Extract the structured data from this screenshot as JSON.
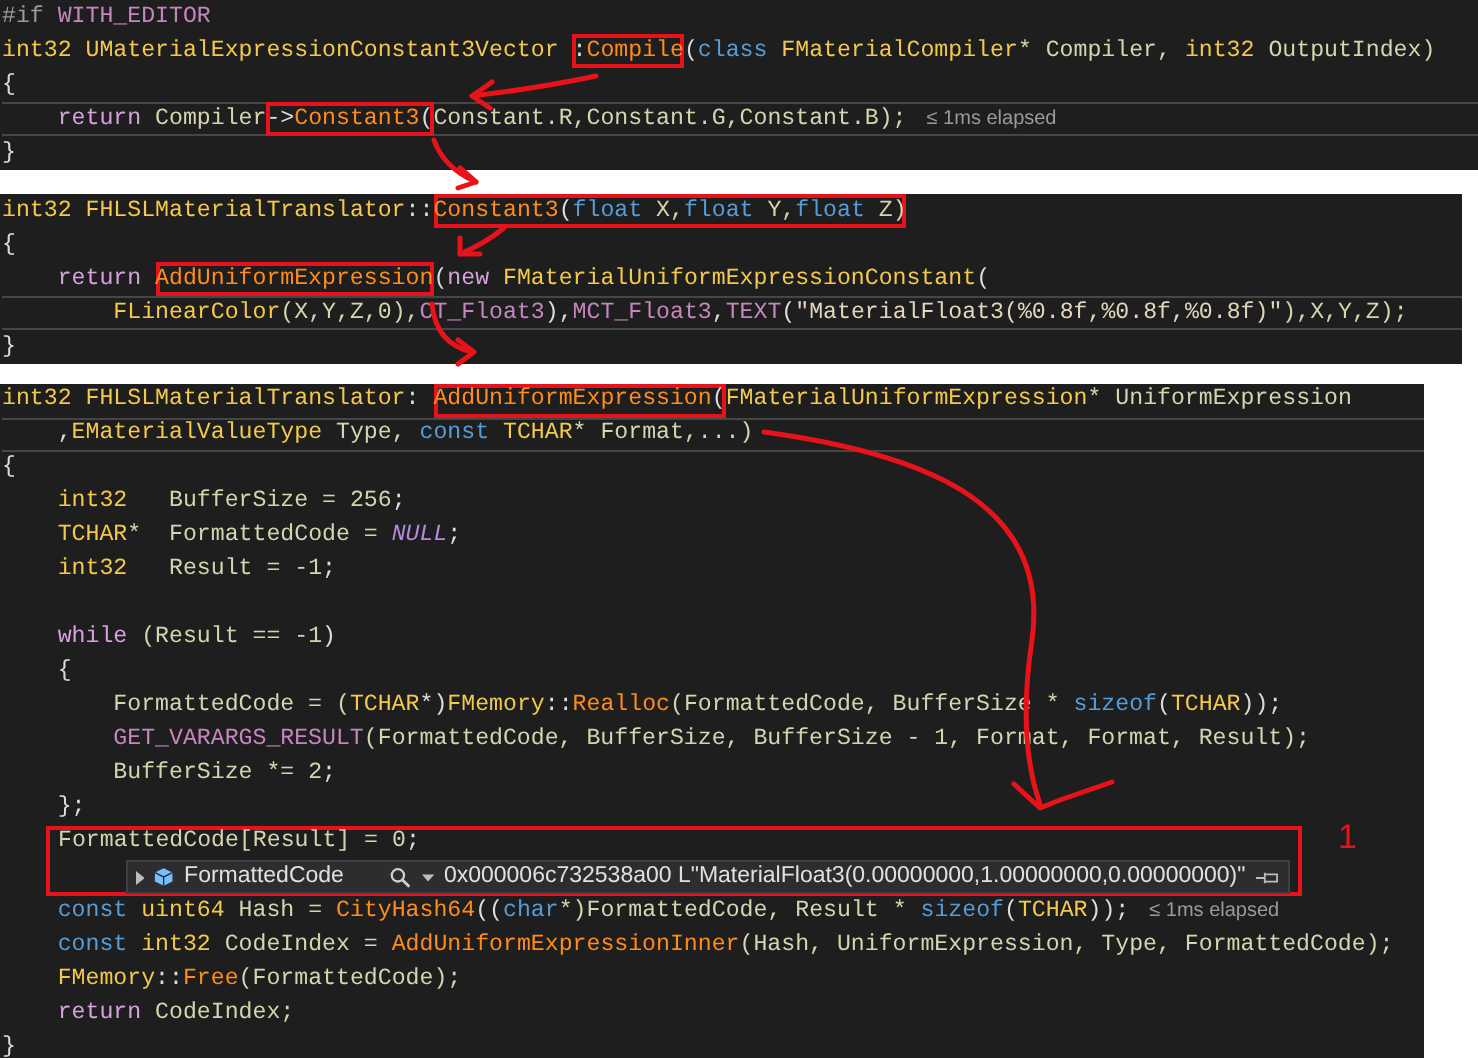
{
  "panels": [
    {
      "lines": [
        {
          "kind": "code",
          "current": false,
          "tokens": [
            {
              "text": "#if ",
              "kind": "pre"
            },
            {
              "text": "WITH_EDITOR",
              "kind": "macro"
            }
          ]
        },
        {
          "kind": "code",
          "current": false,
          "tokens": [
            {
              "text": "int32 ",
              "kind": "type"
            },
            {
              "text": "UMaterialExpressionConstant3Vector ",
              "kind": "type"
            },
            {
              "kind": "box",
              "tokens": [
                {
                  "text": ":",
                  "kind": "p"
                },
                {
                  "text": "Compile",
                  "kind": "fn"
                }
              ]
            },
            {
              "text": "(",
              "kind": "p"
            },
            {
              "text": "class ",
              "kind": "kw2"
            },
            {
              "text": "FMaterialCompiler",
              "kind": "type"
            },
            {
              "text": "* Compiler, ",
              "kind": "id"
            },
            {
              "text": "int32",
              "kind": "type"
            },
            {
              "text": " OutputIndex)",
              "kind": "id"
            }
          ]
        },
        {
          "kind": "code",
          "current": false,
          "tokens": [
            {
              "text": "{",
              "kind": "p"
            }
          ]
        },
        {
          "kind": "code",
          "current": true,
          "tokens": [
            {
              "text": "    return",
              "kind": "kw"
            },
            {
              "text": " Compiler",
              "kind": "id"
            },
            {
              "kind": "box",
              "tokens": [
                {
                  "text": "->",
                  "kind": "p"
                },
                {
                  "text": "Constant3",
                  "kind": "fn"
                },
                {
                  "text": "(",
                  "kind": "p"
                }
              ]
            },
            {
              "text": "Constant.R,Constant.G,Constant.B);",
              "kind": "id"
            },
            {
              "text": "≤ 1ms elapsed",
              "kind": "perf"
            }
          ]
        },
        {
          "kind": "code",
          "current": false,
          "tokens": [
            {
              "text": "}",
              "kind": "p"
            }
          ]
        }
      ]
    },
    {
      "lines": [
        {
          "kind": "code",
          "current": false,
          "tokens": [
            {
              "text": "int32 ",
              "kind": "type"
            },
            {
              "text": "FHLSLMaterialTranslator",
              "kind": "type"
            },
            {
              "text": "::",
              "kind": "p"
            },
            {
              "kind": "box",
              "tokens": [
                {
                  "text": "Constant3",
                  "kind": "fn"
                },
                {
                  "text": "(",
                  "kind": "p"
                },
                {
                  "text": "float",
                  "kind": "kw2"
                },
                {
                  "text": " X,",
                  "kind": "id"
                },
                {
                  "text": "float",
                  "kind": "kw2"
                },
                {
                  "text": " Y,",
                  "kind": "id"
                },
                {
                  "text": "float",
                  "kind": "kw2"
                },
                {
                  "text": " Z)",
                  "kind": "id"
                }
              ]
            }
          ]
        },
        {
          "kind": "code",
          "current": false,
          "tokens": [
            {
              "text": "{",
              "kind": "p"
            }
          ]
        },
        {
          "kind": "code",
          "current": false,
          "tokens": [
            {
              "text": "    return ",
              "kind": "kw"
            },
            {
              "kind": "box",
              "tokens": [
                {
                  "text": "AddUniformExpression",
                  "kind": "fn"
                }
              ]
            },
            {
              "text": "(",
              "kind": "p"
            },
            {
              "text": "new ",
              "kind": "kw"
            },
            {
              "text": "FMaterialUniformExpressionConstant",
              "kind": "type"
            },
            {
              "text": "(",
              "kind": "p"
            }
          ]
        },
        {
          "kind": "code",
          "current": true,
          "tokens": [
            {
              "text": "        FLinearColor",
              "kind": "type"
            },
            {
              "text": "(X,Y,Z,0),",
              "kind": "id"
            },
            {
              "text": "CT_Float3",
              "kind": "macro"
            },
            {
              "text": "),",
              "kind": "p"
            },
            {
              "text": "MCT_Float3",
              "kind": "macro"
            },
            {
              "text": ",",
              "kind": "p"
            },
            {
              "text": "TEXT",
              "kind": "macro"
            },
            {
              "text": "(",
              "kind": "p"
            },
            {
              "text": "\"MaterialFloat3(%0.8f,%0.8f,%0.8f)\"",
              "kind": "str"
            },
            {
              "text": "),X,Y,Z);",
              "kind": "id"
            }
          ]
        },
        {
          "kind": "code",
          "current": false,
          "tokens": [
            {
              "text": "}",
              "kind": "p"
            }
          ]
        }
      ]
    },
    {
      "lines": [
        {
          "kind": "code",
          "current": false,
          "tokens": [
            {
              "text": "int32 ",
              "kind": "type"
            },
            {
              "text": "FHLSLMaterialTranslator",
              "kind": "type"
            },
            {
              "text": ": ",
              "kind": "p"
            },
            {
              "kind": "box",
              "tokens": [
                {
                  "text": "AddUniformExpression",
                  "kind": "fn"
                },
                {
                  "text": "(",
                  "kind": "p"
                }
              ]
            },
            {
              "text": "FMaterialUniformExpression",
              "kind": "type"
            },
            {
              "text": "* UniformExpression",
              "kind": "id"
            }
          ]
        },
        {
          "kind": "code",
          "current": true,
          "tokens": [
            {
              "text": "    ,",
              "kind": "p"
            },
            {
              "text": "EMaterialValueType",
              "kind": "type"
            },
            {
              "text": " Type, ",
              "kind": "id"
            },
            {
              "text": "const ",
              "kind": "kw2"
            },
            {
              "text": "TCHAR",
              "kind": "type"
            },
            {
              "text": "* Format,...)",
              "kind": "id"
            }
          ]
        },
        {
          "kind": "code",
          "current": false,
          "tokens": [
            {
              "text": "{",
              "kind": "p"
            }
          ]
        },
        {
          "kind": "code",
          "current": false,
          "tokens": [
            {
              "text": "    int32",
              "kind": "type"
            },
            {
              "text": "   BufferSize = ",
              "kind": "id"
            },
            {
              "text": "256",
              "kind": "num"
            },
            {
              "text": ";",
              "kind": "p"
            }
          ]
        },
        {
          "kind": "code",
          "current": false,
          "tokens": [
            {
              "text": "    TCHAR",
              "kind": "type"
            },
            {
              "text": "*  FormattedCode = ",
              "kind": "id"
            },
            {
              "text": "NULL",
              "kind": "null"
            },
            {
              "text": ";",
              "kind": "p"
            }
          ]
        },
        {
          "kind": "code",
          "current": false,
          "tokens": [
            {
              "text": "    int32",
              "kind": "type"
            },
            {
              "text": "   Result = ",
              "kind": "id"
            },
            {
              "text": "-1",
              "kind": "num"
            },
            {
              "text": ";",
              "kind": "p"
            }
          ]
        },
        {
          "kind": "blank",
          "current": false
        },
        {
          "kind": "code",
          "current": false,
          "tokens": [
            {
              "text": "    while",
              "kind": "kw"
            },
            {
              "text": " (Result == ",
              "kind": "id"
            },
            {
              "text": "-1",
              "kind": "num"
            },
            {
              "text": ")",
              "kind": "p"
            }
          ]
        },
        {
          "kind": "code",
          "current": false,
          "tokens": [
            {
              "text": "    {",
              "kind": "p"
            }
          ]
        },
        {
          "kind": "code",
          "current": false,
          "tokens": [
            {
              "text": "        FormattedCode = (",
              "kind": "id"
            },
            {
              "text": "TCHAR",
              "kind": "type"
            },
            {
              "text": "*)",
              "kind": "p"
            },
            {
              "text": "FMemory",
              "kind": "type"
            },
            {
              "text": "::",
              "kind": "p"
            },
            {
              "text": "Realloc",
              "kind": "fn"
            },
            {
              "text": "(FormattedCode, BufferSize * ",
              "kind": "id"
            },
            {
              "text": "sizeof",
              "kind": "kw2"
            },
            {
              "text": "(",
              "kind": "p"
            },
            {
              "text": "TCHAR",
              "kind": "type"
            },
            {
              "text": "));",
              "kind": "p"
            }
          ]
        },
        {
          "kind": "code",
          "current": false,
          "tokens": [
            {
              "text": "        GET_VARARGS_RESULT",
              "kind": "macro"
            },
            {
              "text": "(FormattedCode, BufferSize, BufferSize - 1, Format, Format, Result);",
              "kind": "id"
            }
          ]
        },
        {
          "kind": "code",
          "current": false,
          "tokens": [
            {
              "text": "        BufferSize *= ",
              "kind": "id"
            },
            {
              "text": "2",
              "kind": "num"
            },
            {
              "text": ";",
              "kind": "p"
            }
          ]
        },
        {
          "kind": "code",
          "current": false,
          "tokens": [
            {
              "text": "    };",
              "kind": "p"
            }
          ]
        },
        {
          "kind": "callout",
          "label": "1",
          "code": [
            {
              "text": "FormattedCode[Result] = ",
              "kind": "id"
            },
            {
              "text": "0",
              "kind": "num"
            },
            {
              "text": ";",
              "kind": "p"
            }
          ],
          "datatip": {
            "name": "FormattedCode",
            "value": "0x000006c732538a00 L\"MaterialFloat3(0.00000000,1.00000000,0.00000000)\""
          }
        },
        {
          "kind": "code",
          "current": false,
          "tokens": [
            {
              "text": "    const ",
              "kind": "kw2"
            },
            {
              "text": "uint64",
              "kind": "type"
            },
            {
              "text": " Hash = ",
              "kind": "id"
            },
            {
              "text": "CityHash64",
              "kind": "fn"
            },
            {
              "text": "((",
              "kind": "p"
            },
            {
              "text": "char",
              "kind": "kw2"
            },
            {
              "text": "*)FormattedCode, Result * ",
              "kind": "id"
            },
            {
              "text": "sizeof",
              "kind": "kw2"
            },
            {
              "text": "(",
              "kind": "p"
            },
            {
              "text": "TCHAR",
              "kind": "type"
            },
            {
              "text": "));",
              "kind": "p"
            },
            {
              "text": "≤ 1ms elapsed",
              "kind": "perf"
            }
          ]
        },
        {
          "kind": "code",
          "current": false,
          "tokens": [
            {
              "text": "    const ",
              "kind": "kw2"
            },
            {
              "text": "int32",
              "kind": "type"
            },
            {
              "text": " CodeIndex = ",
              "kind": "id"
            },
            {
              "text": "AddUniformExpressionInner",
              "kind": "fn"
            },
            {
              "text": "(Hash, UniformExpression, Type, FormattedCode);",
              "kind": "id"
            }
          ]
        },
        {
          "kind": "code",
          "current": false,
          "tokens": [
            {
              "text": "    FMemory",
              "kind": "type"
            },
            {
              "text": "::",
              "kind": "p"
            },
            {
              "text": "Free",
              "kind": "fn"
            },
            {
              "text": "(FormattedCode);",
              "kind": "id"
            }
          ]
        },
        {
          "kind": "code",
          "current": false,
          "tokens": [
            {
              "text": "    return",
              "kind": "kw"
            },
            {
              "text": " CodeIndex;",
              "kind": "id"
            }
          ]
        },
        {
          "kind": "code",
          "current": false,
          "tokens": [
            {
              "text": "}",
              "kind": "p"
            }
          ]
        }
      ]
    }
  ]
}
